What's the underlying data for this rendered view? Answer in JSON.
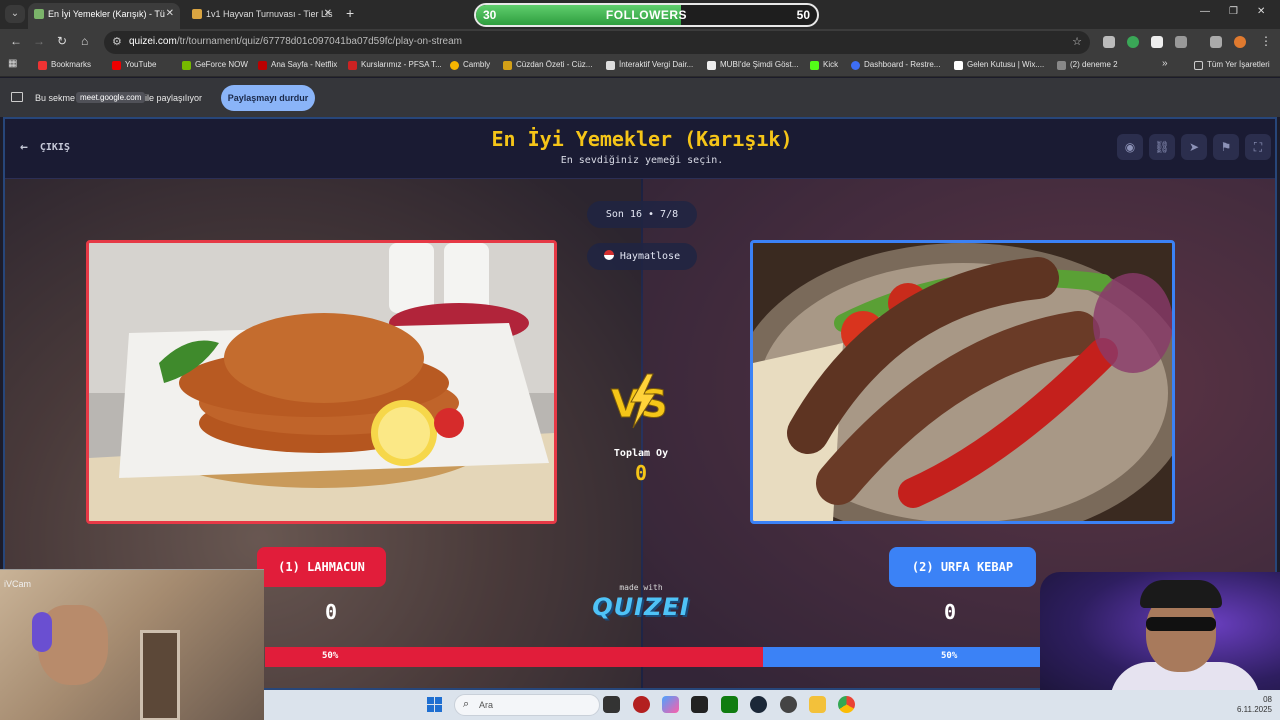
{
  "browser": {
    "tabs": [
      {
        "title": "En İyi Yemekler (Karışık) - Tü",
        "active": true
      },
      {
        "title": "1v1 Hayvan Turnuvası - Tier Lis",
        "active": false
      }
    ],
    "url_host": "quizei.com",
    "url_path": "/tr/tournament/quiz/67778d01c097041ba07d59fc/play-on-stream",
    "bookmarks": [
      "Bookmarks",
      "YouTube",
      "GeForce NOW",
      "Ana Sayfa - Netflix",
      "Kurslarımız - PFSA T...",
      "Cambly",
      "Cüzdan Özeti - Cüz...",
      "İnteraktif Vergi Dair...",
      "MUBI'de Şimdi Göst...",
      "Kick",
      "Dashboard - Restre...",
      "Gelen Kutusu | Wix....",
      "(2) deneme 2"
    ],
    "all_bookmarks": "Tüm Yer İşaretleri",
    "share_prefix": "Bu sekme",
    "share_site": "meet.google.com",
    "share_suffix": "ile paylaşılıyor",
    "stop_sharing": "Paylaşmayı durdur"
  },
  "overlay": {
    "followers_label": "FOLLOWERS",
    "followers_current": "30",
    "followers_goal": "50",
    "followers_progress": 0.6
  },
  "quiz": {
    "exit_label": "ÇIKIŞ",
    "title": "En İyi Yemekler (Karışık)",
    "subtitle": "En sevdiğiniz yemeği seçin.",
    "round": "Son 16 • 7/8",
    "host": "Haymatlose",
    "total_votes_label": "Toplam Oy",
    "total_votes": "0",
    "made_with": "made with",
    "brand": "QUIZEI",
    "left": {
      "label": "(1) LAHMACUN",
      "score": "0",
      "percent_label": "50%",
      "percent": 50
    },
    "right": {
      "label": "(2) URFA KEBAP",
      "score": "0",
      "percent_label": "50%",
      "percent": 50
    }
  },
  "webcam": {
    "label": "iVCam"
  },
  "taskbar": {
    "search_placeholder": "Ara",
    "time": "08",
    "date": "6.11.2025"
  },
  "colors": {
    "accent_gold": "#f5c518",
    "left_red": "#e11d3a",
    "right_blue": "#3b82f6",
    "header_bg": "#1a1b33"
  }
}
